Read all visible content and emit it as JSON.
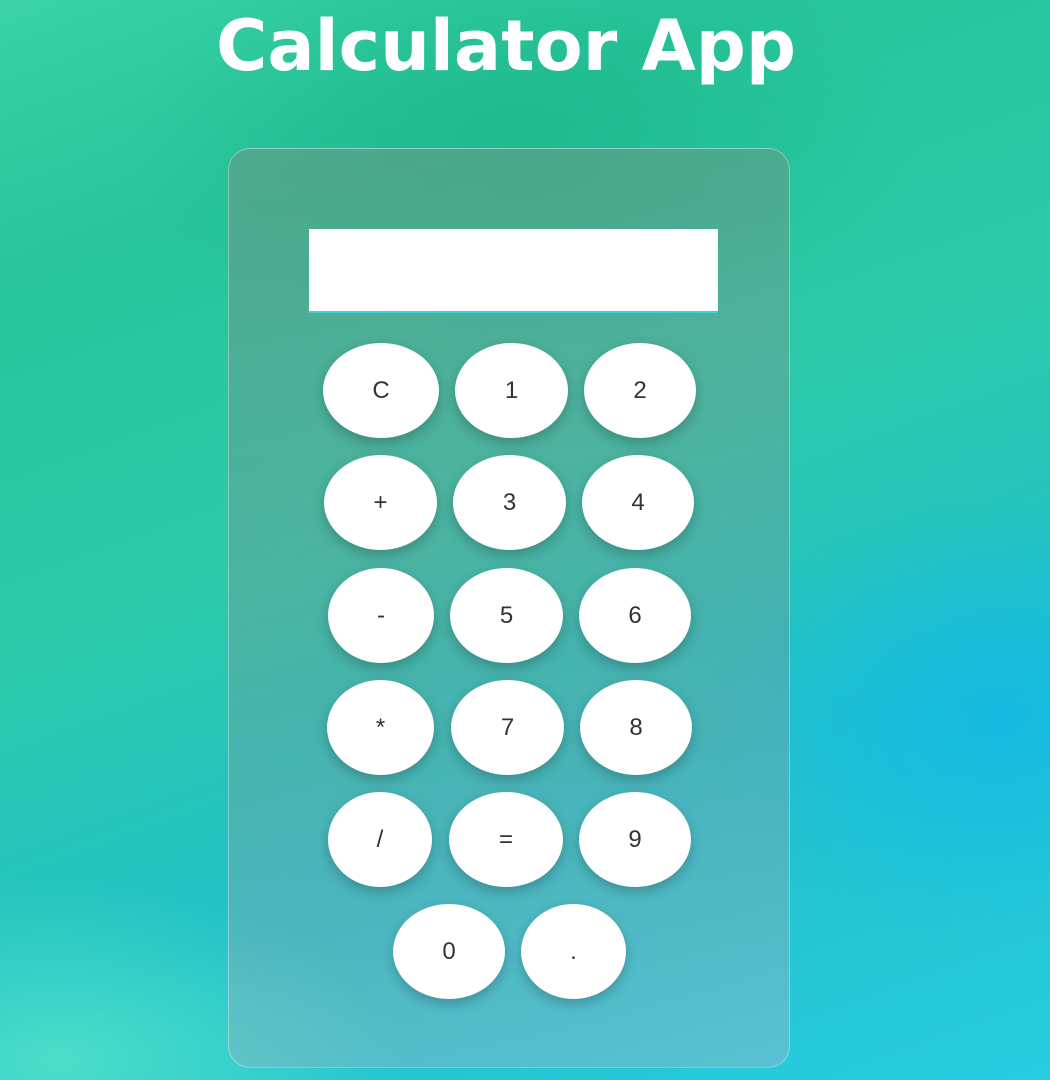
{
  "app": {
    "title": "Calculator App"
  },
  "display": {
    "value": ""
  },
  "keys": {
    "clear": "C",
    "one": "1",
    "two": "2",
    "plus": "+",
    "three": "3",
    "four": "4",
    "minus": "-",
    "five": "5",
    "six": "6",
    "multiply": "*",
    "seven": "7",
    "eight": "8",
    "divide": "/",
    "equals": "=",
    "nine": "9",
    "zero": "0",
    "decimal": "."
  }
}
